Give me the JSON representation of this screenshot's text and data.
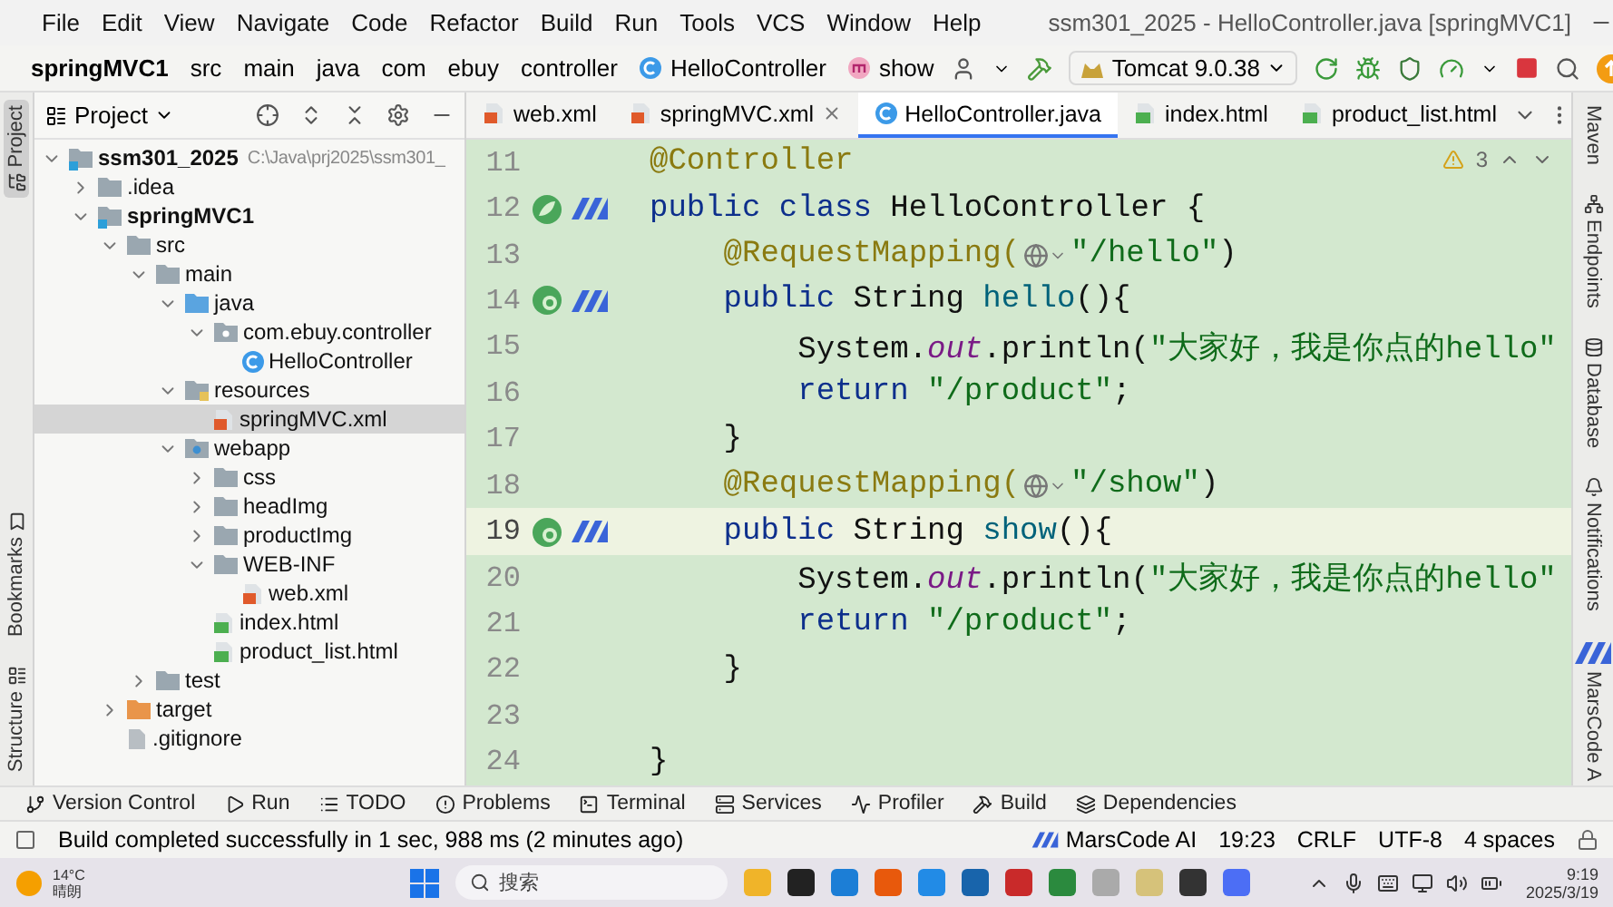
{
  "title_bar": {
    "menu": [
      "File",
      "Edit",
      "View",
      "Navigate",
      "Code",
      "Refactor",
      "Build",
      "Run",
      "Tools",
      "VCS",
      "Window",
      "Help"
    ],
    "title": "ssm301_2025 - HelloController.java [springMVC1]"
  },
  "breadcrumbs": [
    {
      "label": "springMVC1",
      "kind": "module"
    },
    {
      "label": "src",
      "kind": "folder"
    },
    {
      "label": "main",
      "kind": "folder"
    },
    {
      "label": "java",
      "kind": "folder"
    },
    {
      "label": "com",
      "kind": "folder"
    },
    {
      "label": "ebuy",
      "kind": "folder"
    },
    {
      "label": "controller",
      "kind": "folder"
    },
    {
      "label": "HelloController",
      "kind": "class"
    },
    {
      "label": "show",
      "kind": "method"
    }
  ],
  "run_config": "Tomcat 9.0.38",
  "left_strip": [
    {
      "label": "Project",
      "selected": true,
      "kind": "project"
    },
    {
      "label": "Bookmarks",
      "selected": false,
      "kind": "bookmarks"
    },
    {
      "label": "Structure",
      "selected": false,
      "kind": "structure"
    }
  ],
  "project_panel": {
    "title": "Project",
    "tree": [
      {
        "label": "ssm301_2025",
        "path": "C:\\Java\\prj2025\\ssm301_",
        "kind": "module",
        "expanded": true,
        "selected": false,
        "children": [
          {
            "label": ".idea",
            "kind": "folder",
            "expanded": false,
            "selected": false
          },
          {
            "label": "springMVC1",
            "kind": "module",
            "expanded": true,
            "selected": false,
            "children": [
              {
                "label": "src",
                "kind": "folder",
                "expanded": true,
                "selected": false,
                "children": [
                  {
                    "label": "main",
                    "kind": "folder",
                    "expanded": true,
                    "selected": false,
                    "children": [
                      {
                        "label": "java",
                        "kind": "source",
                        "expanded": true,
                        "selected": false,
                        "children": [
                          {
                            "label": "com.ebuy.controller",
                            "kind": "package",
                            "expanded": true,
                            "selected": false,
                            "children": [
                              {
                                "label": "HelloController",
                                "kind": "class",
                                "selected": false
                              }
                            ]
                          }
                        ]
                      },
                      {
                        "label": "resources",
                        "kind": "resources",
                        "expanded": true,
                        "selected": false,
                        "children": [
                          {
                            "label": "springMVC.xml",
                            "kind": "xml",
                            "selected": true
                          }
                        ]
                      },
                      {
                        "label": "webapp",
                        "kind": "webapp",
                        "expanded": true,
                        "selected": false,
                        "children": [
                          {
                            "label": "css",
                            "kind": "folder",
                            "expanded": false,
                            "selected": false
                          },
                          {
                            "label": "headImg",
                            "kind": "folder",
                            "expanded": false,
                            "selected": false
                          },
                          {
                            "label": "productImg",
                            "kind": "folder",
                            "expanded": false,
                            "selected": false
                          },
                          {
                            "label": "WEB-INF",
                            "kind": "folder",
                            "expanded": true,
                            "selected": false,
                            "children": [
                              {
                                "label": "web.xml",
                                "kind": "xml",
                                "selected": false
                              }
                            ]
                          },
                          {
                            "label": "index.html",
                            "kind": "html",
                            "selected": false
                          },
                          {
                            "label": "product_list.html",
                            "kind": "html",
                            "selected": false
                          }
                        ]
                      }
                    ]
                  },
                  {
                    "label": "test",
                    "kind": "folder",
                    "expanded": false,
                    "selected": false
                  }
                ]
              },
              {
                "label": "target",
                "kind": "excluded",
                "expanded": false,
                "selected": false
              },
              {
                "label": ".gitignore",
                "kind": "file",
                "selected": false
              }
            ]
          }
        ]
      }
    ]
  },
  "editor_tabs": [
    {
      "label": "web.xml",
      "kind": "xml",
      "selected": false,
      "closable": false
    },
    {
      "label": "springMVC.xml",
      "kind": "xml",
      "selected": false,
      "closable": true
    },
    {
      "label": "HelloController.java",
      "kind": "class",
      "selected": true,
      "closable": false
    },
    {
      "label": "index.html",
      "kind": "html",
      "selected": false,
      "closable": false
    },
    {
      "label": "product_list.html",
      "kind": "html",
      "selected": false,
      "closable": false
    }
  ],
  "editor": {
    "warning_count": "3",
    "lines": [
      {
        "number": "11",
        "current": false,
        "tokens": [
          {
            "text": "@Controller",
            "kind": "annotation"
          }
        ]
      },
      {
        "number": "12",
        "current": false,
        "gutter": [
          {
            "kind": "bean"
          },
          {
            "kind": "marscode"
          }
        ],
        "tokens": [
          {
            "text": "public class ",
            "kind": "keyword"
          },
          {
            "text": "HelloController {",
            "kind": "plain"
          }
        ]
      },
      {
        "number": "13",
        "current": false,
        "tokens": [
          {
            "text": "    @RequestMapping(",
            "kind": "annotation"
          },
          {
            "kind": "inlay"
          },
          {
            "text": "\"/hello\"",
            "kind": "string"
          },
          {
            "text": ")",
            "kind": "plain"
          }
        ]
      },
      {
        "number": "14",
        "current": false,
        "gutter": [
          {
            "kind": "web-bean"
          },
          {
            "kind": "marscode"
          }
        ],
        "tokens": [
          {
            "text": "    public ",
            "kind": "keyword"
          },
          {
            "text": "String ",
            "kind": "plain"
          },
          {
            "text": "hello",
            "kind": "method"
          },
          {
            "text": "(){",
            "kind": "plain"
          }
        ]
      },
      {
        "number": "15",
        "current": false,
        "tokens": [
          {
            "text": "        System.",
            "kind": "plain"
          },
          {
            "text": "out",
            "kind": "field"
          },
          {
            "text": ".println(",
            "kind": "plain"
          },
          {
            "text": "\"大家好，我是你点的hello\"",
            "kind": "string"
          }
        ]
      },
      {
        "number": "16",
        "current": false,
        "tokens": [
          {
            "text": "        return ",
            "kind": "keyword"
          },
          {
            "text": "\"/product\"",
            "kind": "string"
          },
          {
            "text": ";",
            "kind": "plain"
          }
        ]
      },
      {
        "number": "17",
        "current": false,
        "tokens": [
          {
            "text": "    }",
            "kind": "plain"
          }
        ]
      },
      {
        "number": "18",
        "current": false,
        "tokens": [
          {
            "text": "    @RequestMapping(",
            "kind": "annotation"
          },
          {
            "kind": "inlay"
          },
          {
            "text": "\"/show\"",
            "kind": "string"
          },
          {
            "text": ")",
            "kind": "plain"
          }
        ]
      },
      {
        "number": "19",
        "current": true,
        "gutter": [
          {
            "kind": "web-bean"
          },
          {
            "kind": "marscode"
          }
        ],
        "tokens": [
          {
            "text": "    public ",
            "kind": "keyword"
          },
          {
            "text": "String ",
            "kind": "plain"
          },
          {
            "text": "show",
            "kind": "method"
          },
          {
            "text": "(){",
            "kind": "plain"
          }
        ]
      },
      {
        "number": "20",
        "current": false,
        "tokens": [
          {
            "text": "        System.",
            "kind": "plain"
          },
          {
            "text": "out",
            "kind": "field"
          },
          {
            "text": ".println(",
            "kind": "plain"
          },
          {
            "text": "\"大家好，我是你点的hello\"",
            "kind": "string"
          }
        ]
      },
      {
        "number": "21",
        "current": false,
        "tokens": [
          {
            "text": "        return ",
            "kind": "keyword"
          },
          {
            "text": "\"/product\"",
            "kind": "string"
          },
          {
            "text": ";",
            "kind": "plain"
          }
        ]
      },
      {
        "number": "22",
        "current": false,
        "tokens": [
          {
            "text": "    }",
            "kind": "plain"
          }
        ]
      },
      {
        "number": "23",
        "current": false
      },
      {
        "number": "24",
        "current": false,
        "tokens": [
          {
            "text": "}",
            "kind": "plain"
          }
        ]
      }
    ]
  },
  "right_strip": [
    {
      "label": "Maven",
      "kind": "maven"
    },
    {
      "label": "Endpoints",
      "kind": "endpoints"
    },
    {
      "label": "Database",
      "kind": "database"
    },
    {
      "label": "Notifications",
      "kind": "notifications"
    },
    {
      "label": "MarsCode A",
      "kind": "marscode"
    }
  ],
  "bottom_tools": [
    {
      "label": "Version Control",
      "kind": "vcs"
    },
    {
      "label": "Run",
      "kind": "run"
    },
    {
      "label": "TODO",
      "kind": "todo"
    },
    {
      "label": "Problems",
      "kind": "problems"
    },
    {
      "label": "Terminal",
      "kind": "terminal"
    },
    {
      "label": "Services",
      "kind": "services"
    },
    {
      "label": "Profiler",
      "kind": "profiler"
    },
    {
      "label": "Build",
      "kind": "build"
    },
    {
      "label": "Dependencies",
      "kind": "dependencies"
    }
  ],
  "status_bar": {
    "message": "Build completed successfully in 1 sec, 988 ms (2 minutes ago)",
    "items": [
      {
        "label": "MarsCode AI",
        "kind": "marscode"
      },
      {
        "label": "19:23",
        "kind": "text"
      },
      {
        "label": "CRLF",
        "kind": "text"
      },
      {
        "label": "UTF-8",
        "kind": "text"
      },
      {
        "label": "4 spaces",
        "kind": "text"
      }
    ]
  },
  "taskbar": {
    "temperature": "14°C",
    "weather": "晴朗",
    "search_placeholder": "搜索",
    "time": "9:19",
    "date": "2025/3/19"
  }
}
